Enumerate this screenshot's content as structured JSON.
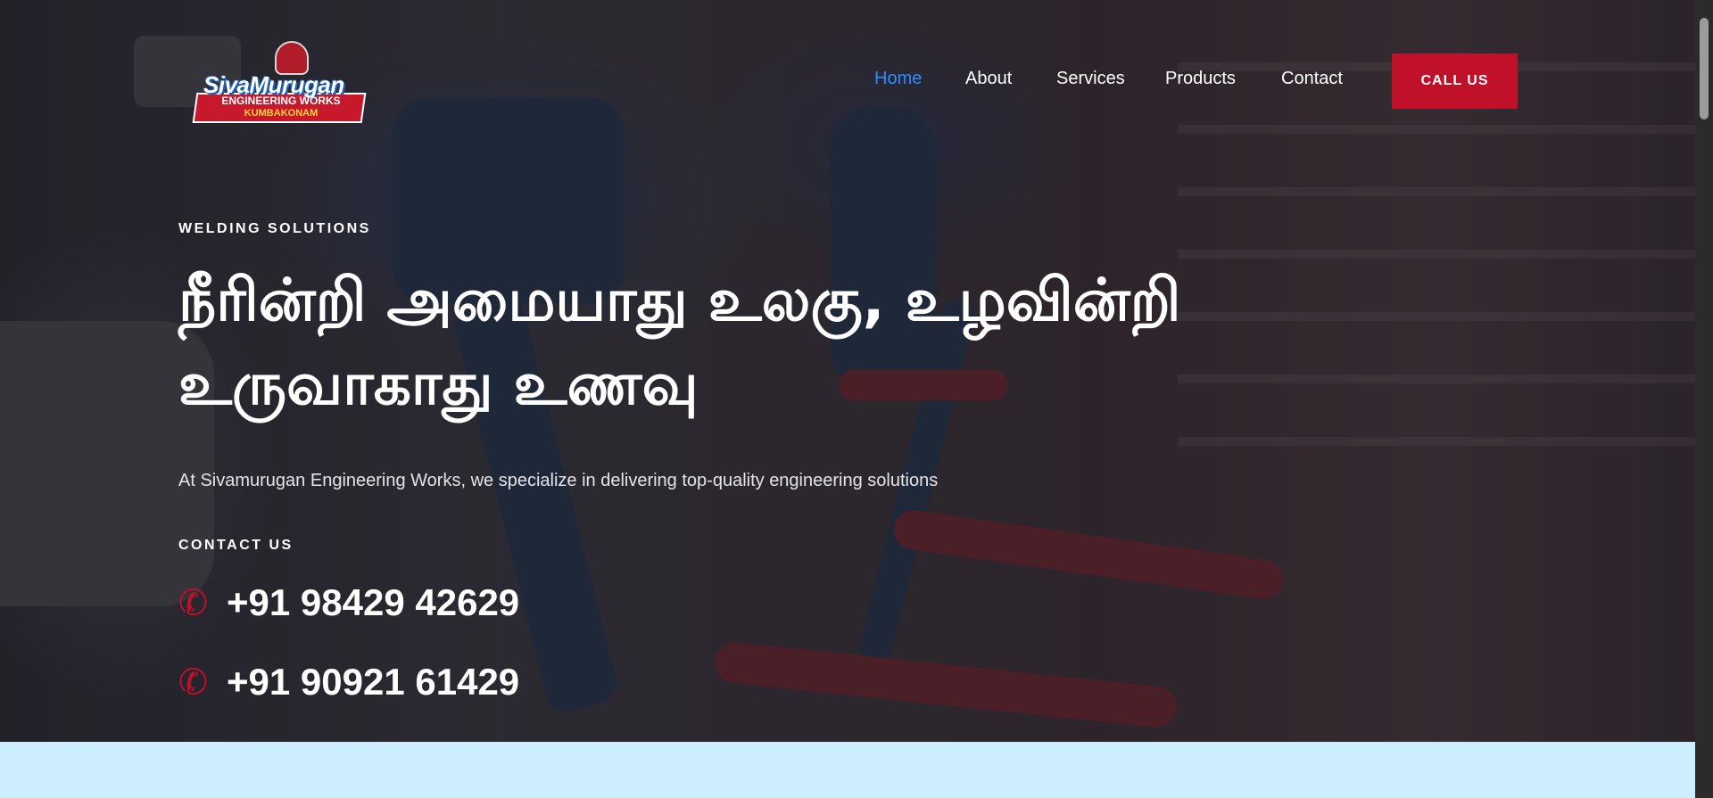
{
  "brand": {
    "logo_name": "SivaMurugan",
    "logo_line1": "ENGINEERING WORKS",
    "logo_line2": "KUMBAKONAM"
  },
  "nav": {
    "items": [
      {
        "label": "Home",
        "active": true
      },
      {
        "label": "About",
        "active": false
      },
      {
        "label": "Services",
        "active": false
      },
      {
        "label": "Products",
        "active": false
      },
      {
        "label": "Contact",
        "active": false
      }
    ],
    "cta_label": "CALL US"
  },
  "hero": {
    "eyebrow": "WELDING SOLUTIONS",
    "headline": "நீரின்றி அமையாது உலகு, உழவின்றி உருவாகாது உணவு",
    "subtitle": "At Sivamurugan Engineering Works, we specialize in delivering top-quality engineering solutions",
    "contact_label": "CONTACT US",
    "phones": [
      "+91 98429 42629",
      "+91 90921 61429"
    ]
  },
  "icons": {
    "phone": "phone-icon"
  },
  "colors": {
    "accent_red": "#c0102a",
    "nav_active": "#2f8cff",
    "next_section_bg": "#cdeefe"
  }
}
